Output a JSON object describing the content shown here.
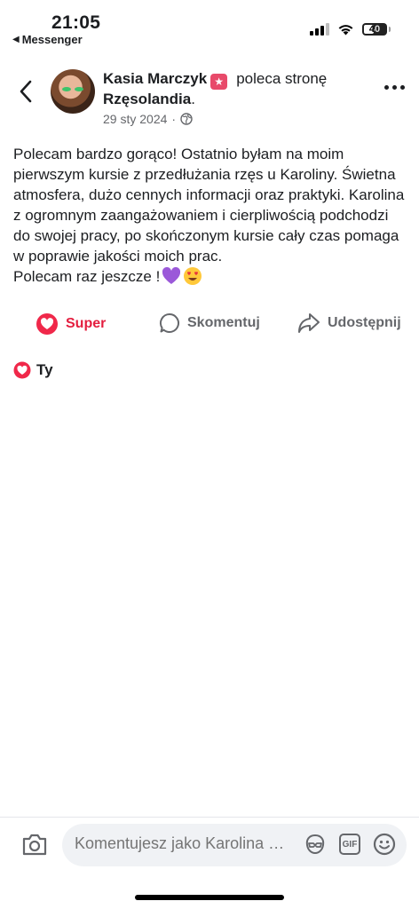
{
  "status_bar": {
    "time": "21:05",
    "back_app": "Messenger",
    "battery": "40"
  },
  "post": {
    "author": "Kasia Marczyk",
    "action": "poleca stronę",
    "page": "Rzęsolandia",
    "page_suffix": ".",
    "date": "29 sty 2024",
    "date_separator": "·",
    "body_lines": [
      "Polecam bardzo gorąco! Ostatnio byłam na moim pierwszym kursie z przedłużania rzęs u Karoliny. Świetna atmosfera, dużo cennych informacji oraz praktyki. Karolina z ogromnym zaangażowaniem i cierpliwością podchodzi do swojej pracy, po skończonym kursie cały czas pomaga w poprawie jakości moich prac.",
      "Polecam raz jeszcze !"
    ],
    "icons": {
      "badge": "recommend-badge-icon",
      "privacy": "globe-icon"
    }
  },
  "actions": {
    "super": "Super",
    "comment": "Skomentuj",
    "share": "Udostępnij"
  },
  "reactions": {
    "you": "Ty"
  },
  "comment_bar": {
    "placeholder": "Komentujesz jako Karolina Puchała"
  },
  "colors": {
    "accent_red": "#e41e3f",
    "text": "#1c1e21",
    "secondary": "#65676b",
    "input_bg": "#f0f2f5"
  }
}
